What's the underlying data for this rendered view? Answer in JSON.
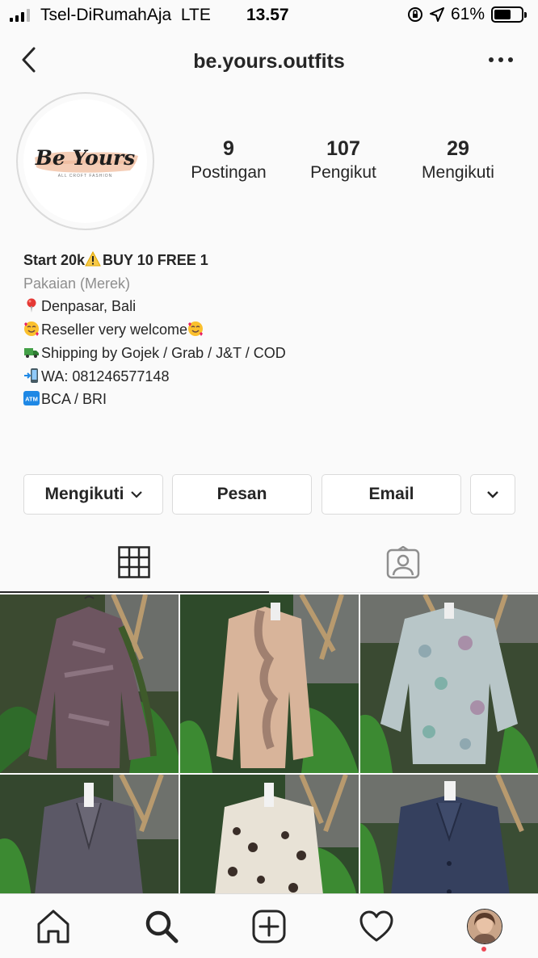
{
  "status_bar": {
    "carrier": "Tsel-DiRumahAja",
    "network": "LTE",
    "time": "13.57",
    "battery_percent": "61%",
    "battery_level": 0.61
  },
  "header": {
    "username": "be.yours.outfits"
  },
  "avatar": {
    "logo_text": "Be Yours",
    "logo_subtext": "ALL CROFT FASHION"
  },
  "stats": [
    {
      "value": "9",
      "label": "Postingan"
    },
    {
      "value": "107",
      "label": "Pengikut"
    },
    {
      "value": "29",
      "label": "Mengikuti"
    }
  ],
  "bio": {
    "name_before": "Start 20k",
    "name_after": "BUY 10 FREE 1",
    "category": "Pakaian (Merek)",
    "location": "Denpasar, Bali",
    "reseller": "Reseller very welcome",
    "shipping": "Shipping by Gojek / Grab / J&T / COD",
    "whatsapp": "WA: 081246577148",
    "bank": "BCA / BRI"
  },
  "buttons": {
    "following": "Mengikuti",
    "message": "Pesan",
    "email": "Email"
  },
  "icons": {
    "back": "chevron-left-icon",
    "more": "more-horizontal-icon",
    "grid": "grid-icon",
    "tagged": "tagged-person-icon",
    "home": "home-icon",
    "search": "search-icon",
    "add": "add-post-icon",
    "activity": "heart-icon",
    "profile": "profile-avatar"
  },
  "colors": {
    "background": "#fafafa",
    "border": "#dbdbdb",
    "text": "#262626",
    "secondary_text": "#8e8e8e",
    "notification_dot": "#ed4956"
  },
  "posts": [
    {
      "caption": "brown patterned blouse"
    },
    {
      "caption": "beige ruffle blouse"
    },
    {
      "caption": "floral print blouse"
    },
    {
      "caption": "grey collared jacket"
    },
    {
      "caption": "leopard print blouse"
    },
    {
      "caption": "navy button jacket"
    }
  ]
}
